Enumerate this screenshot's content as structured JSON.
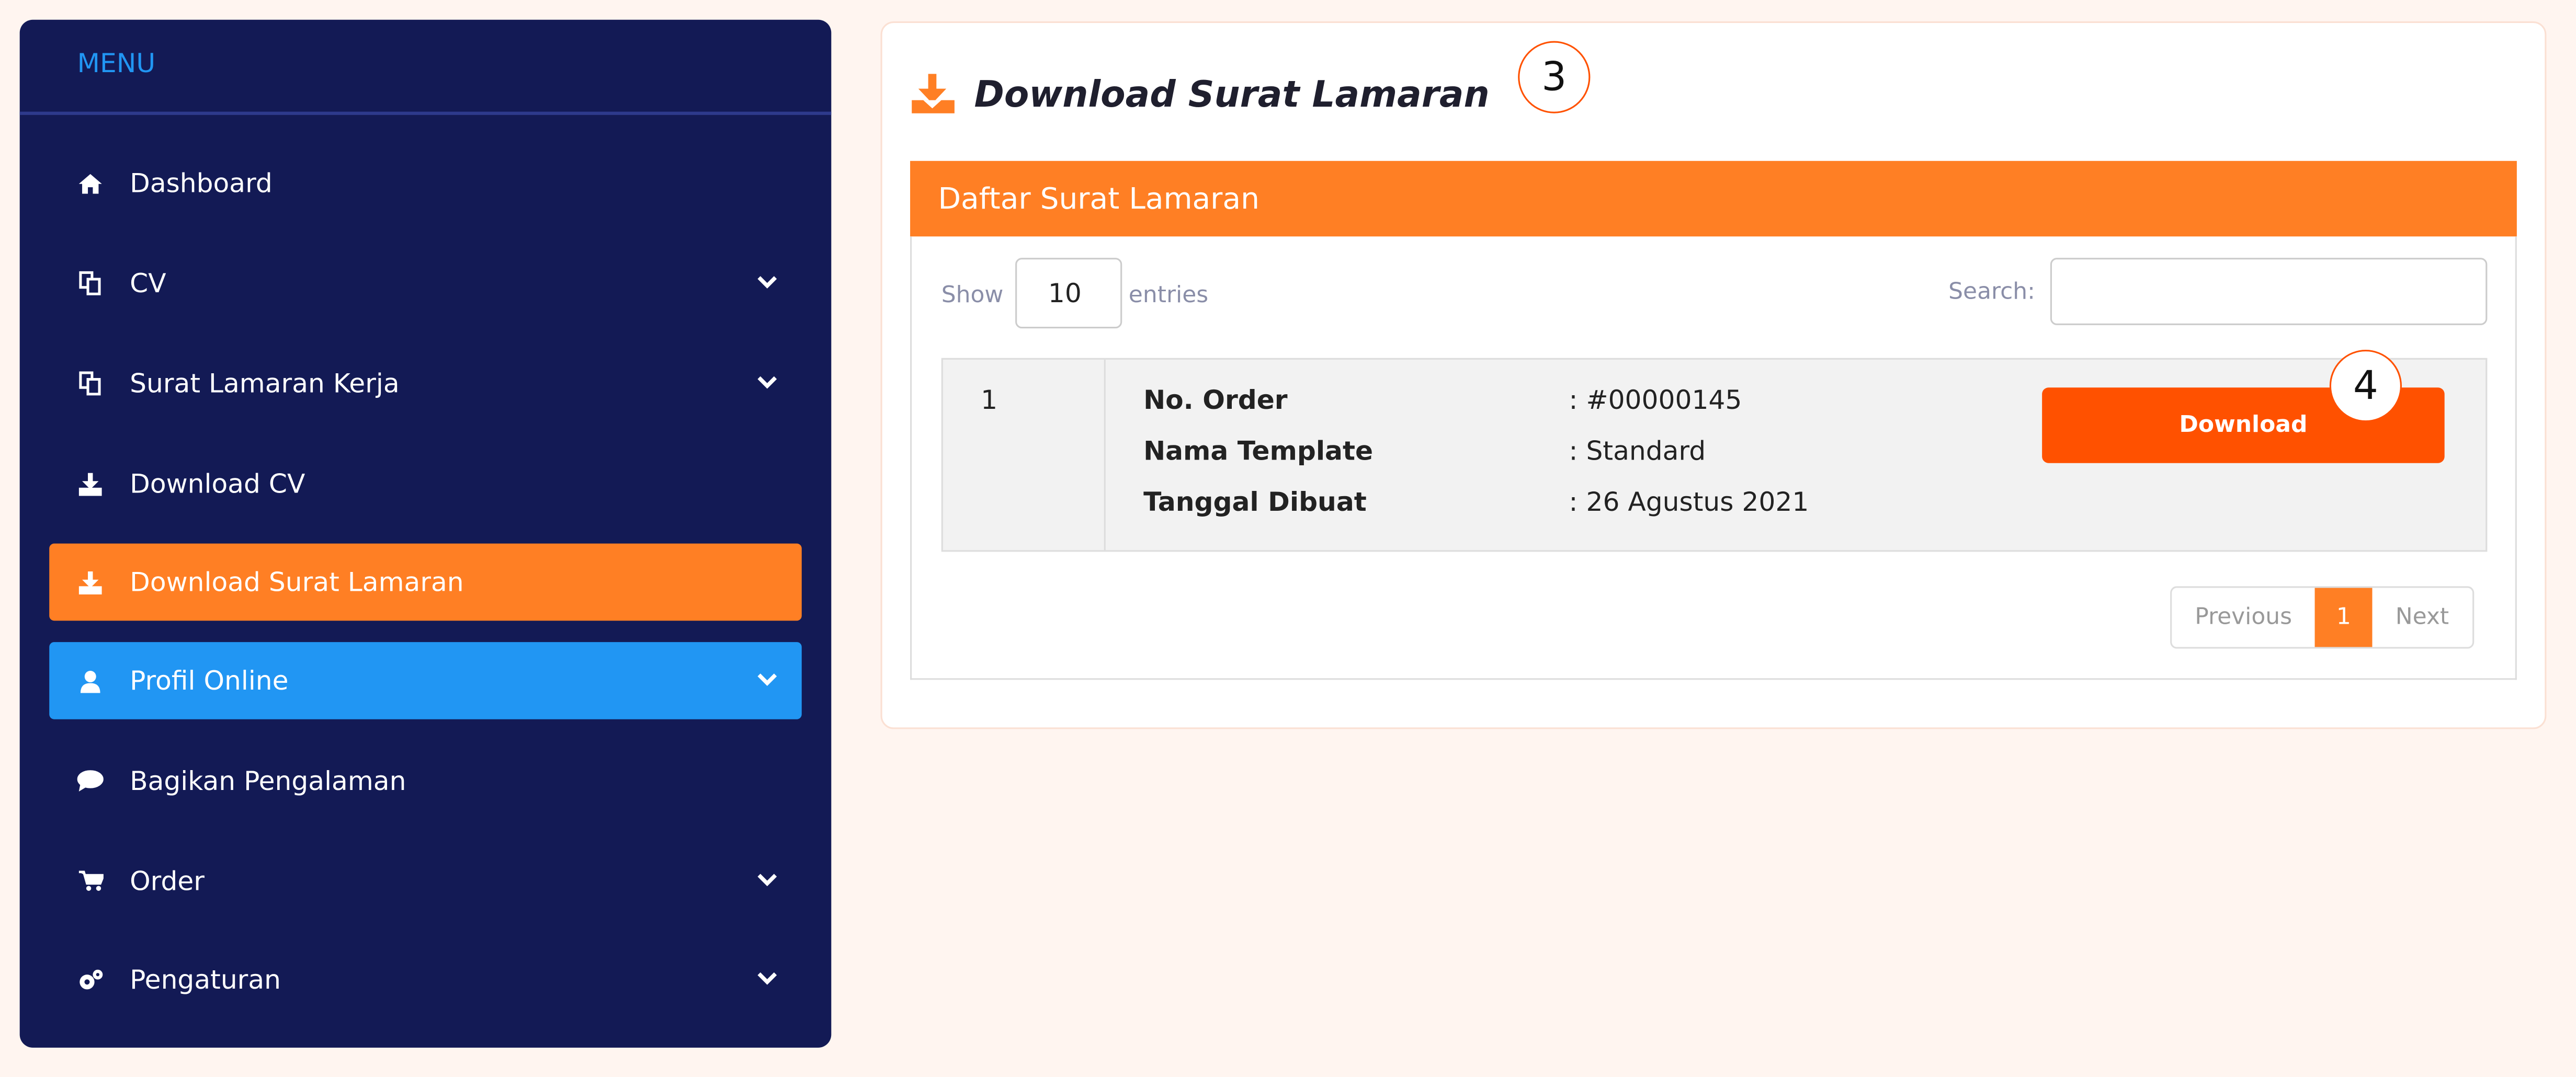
{
  "sidebar": {
    "title": "MENU",
    "items": [
      {
        "label": "Dashboard",
        "icon": "home-icon",
        "chevron": false
      },
      {
        "label": "CV",
        "icon": "copy-icon",
        "chevron": true
      },
      {
        "label": "Surat Lamaran Kerja",
        "icon": "copy-icon",
        "chevron": true
      },
      {
        "label": "Download CV",
        "icon": "download-icon",
        "chevron": false
      },
      {
        "label": "Download Surat Lamaran",
        "icon": "download-icon",
        "chevron": false,
        "active": true
      },
      {
        "label": "Profil Online",
        "icon": "user-icon",
        "chevron": true,
        "highlight": true
      },
      {
        "label": "Bagikan Pengalaman",
        "icon": "comment-icon",
        "chevron": false
      },
      {
        "label": "Order",
        "icon": "cart-icon",
        "chevron": true
      },
      {
        "label": "Pengaturan",
        "icon": "gears-icon",
        "chevron": true
      }
    ]
  },
  "main": {
    "title": "Download Surat Lamaran",
    "step_badges": [
      "3",
      "4"
    ],
    "panel_title": "Daftar Surat Lamaran",
    "show_label": "Show",
    "entries_value": "10",
    "entries_label": "entries",
    "search_label": "Search:",
    "search_value": "",
    "rows": [
      {
        "number": "1",
        "fields": [
          {
            "label": "No. Order",
            "value": ": #00000145"
          },
          {
            "label": "Nama Template",
            "value": ": Standard"
          },
          {
            "label": "Tanggal Dibuat",
            "value": ": 26 Agustus 2021"
          }
        ],
        "action": "Download"
      }
    ],
    "pagination": {
      "previous": "Previous",
      "current": "1",
      "next": "Next"
    }
  },
  "colors": {
    "sidebar": "#131a55",
    "accent": "#ff7f24",
    "button": "#ff5100",
    "highlight": "#2196f3",
    "background": "#fff5f0"
  }
}
